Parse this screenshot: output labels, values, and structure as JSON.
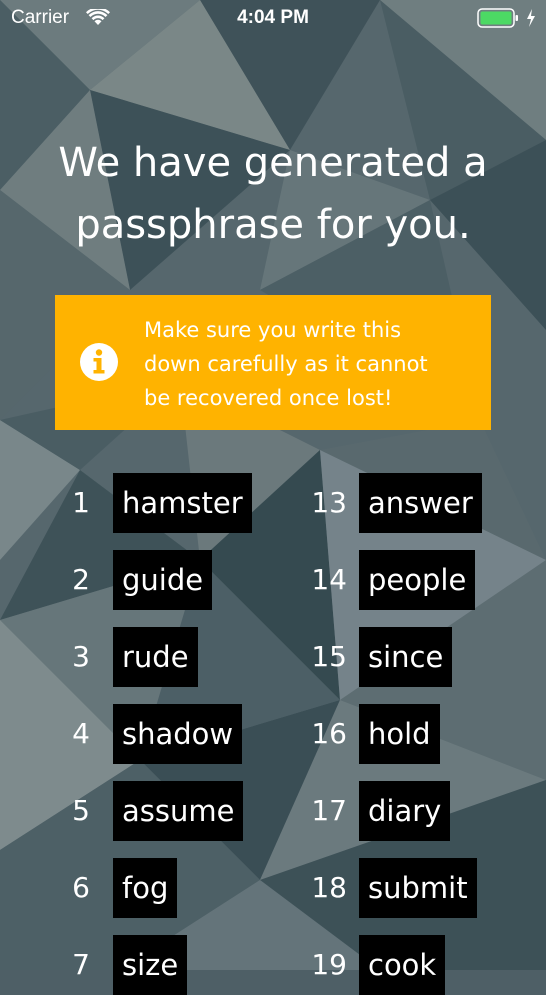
{
  "status_bar": {
    "carrier": "Carrier",
    "time": "4:04 PM",
    "wifi_icon": "wifi-icon",
    "battery_icon": "battery-icon",
    "charging_icon": "charging-bolt-icon"
  },
  "heading": {
    "line1": "We have generated a",
    "line2": "passphrase for you."
  },
  "alert": {
    "icon": "info-icon",
    "text_line1": "Make sure you write this",
    "text_line2": "down carefully as it cannot",
    "text_line3": "be recovered once lost!",
    "color": "#ffb300"
  },
  "words_left": [
    {
      "num": "1",
      "word": "hamster"
    },
    {
      "num": "2",
      "word": "guide"
    },
    {
      "num": "3",
      "word": "rude"
    },
    {
      "num": "4",
      "word": "shadow"
    },
    {
      "num": "5",
      "word": "assume"
    },
    {
      "num": "6",
      "word": "fog"
    },
    {
      "num": "7",
      "word": "size"
    }
  ],
  "words_right": [
    {
      "num": "13",
      "word": "answer"
    },
    {
      "num": "14",
      "word": "people"
    },
    {
      "num": "15",
      "word": "since"
    },
    {
      "num": "16",
      "word": "hold"
    },
    {
      "num": "17",
      "word": "diary"
    },
    {
      "num": "18",
      "word": "submit"
    },
    {
      "num": "19",
      "word": "cook"
    }
  ]
}
